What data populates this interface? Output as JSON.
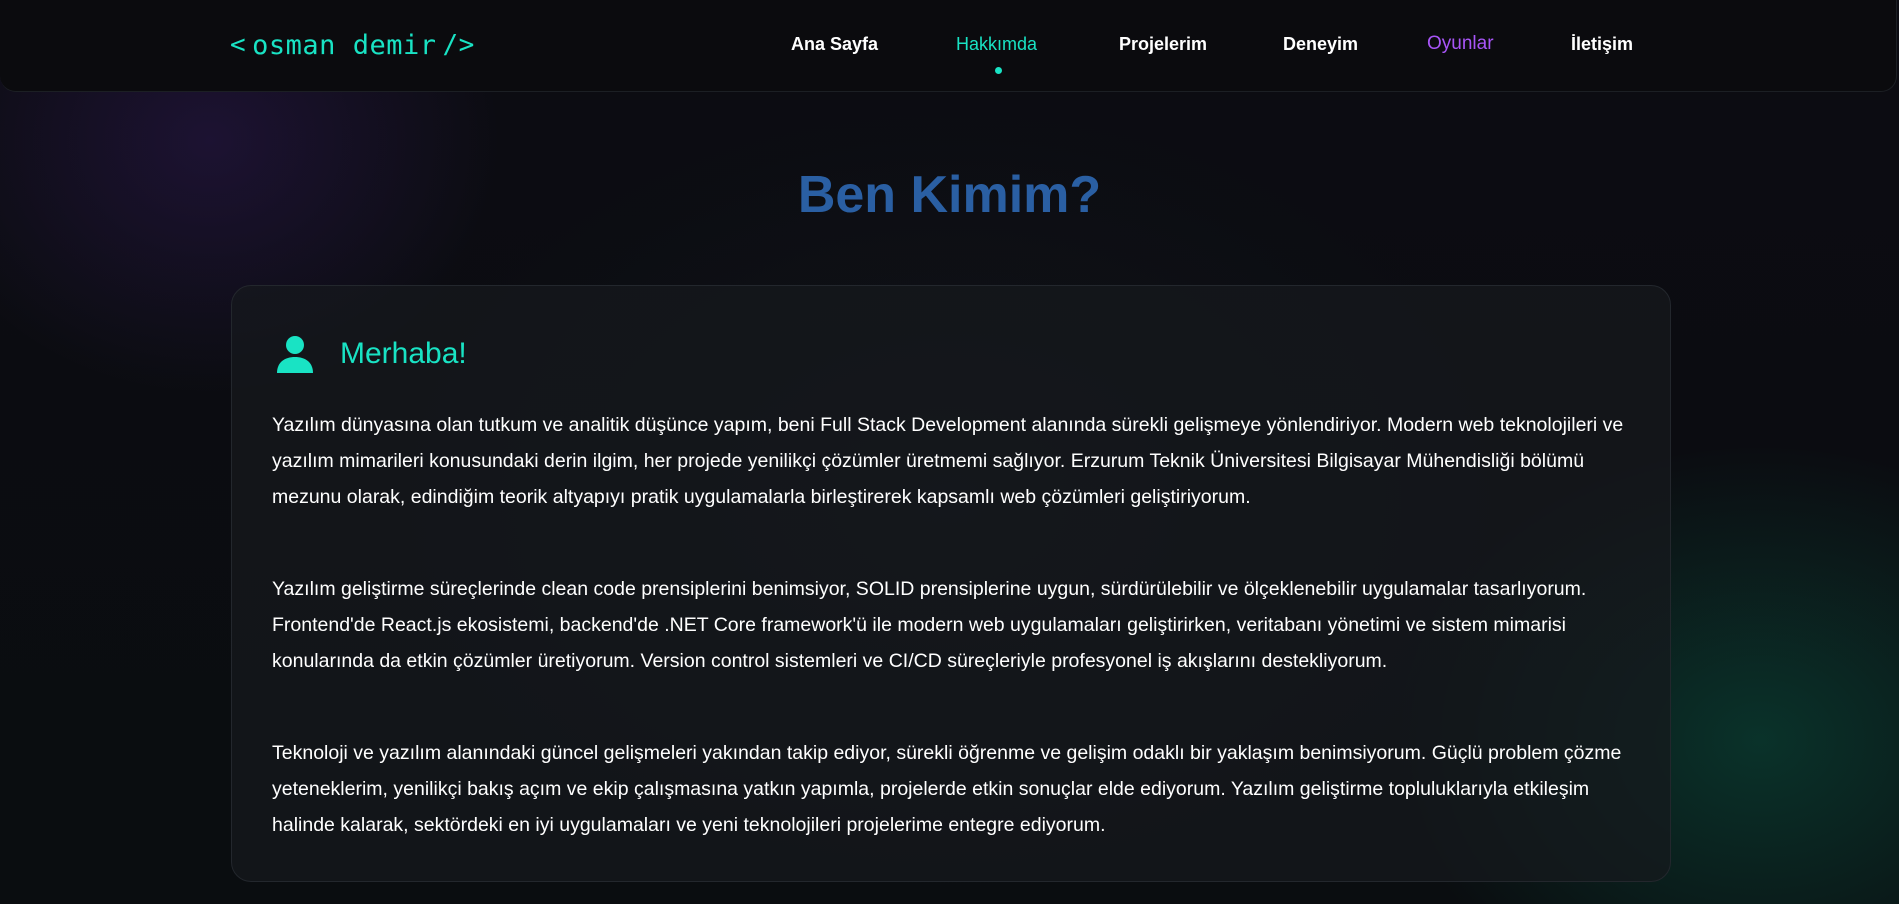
{
  "header": {
    "logo": {
      "open_bracket": "<",
      "name": "osman demir",
      "close_bracket": "/>"
    },
    "nav": [
      {
        "label": "Ana Sayfa"
      },
      {
        "label": "Hakkımda",
        "active": true
      },
      {
        "label": "Projelerim"
      },
      {
        "label": "Deneyim"
      },
      {
        "label": "Oyunlar"
      },
      {
        "label": "İletişim"
      }
    ]
  },
  "main": {
    "title": "Ben Kimim?",
    "card": {
      "icon": "user-icon",
      "heading": "Merhaba!",
      "paragraphs": [
        "Yazılım dünyasına olan tutkum ve analitik düşünce yapım, beni Full Stack Development alanında sürekli gelişmeye yönlendiriyor. Modern web teknolojileri ve yazılım mimarileri konusundaki derin ilgim, her projede yenilikçi çözümler üretmemi sağlıyor. Erzurum Teknik Üniversitesi Bilgisayar Mühendisliği bölümü mezunu olarak, edindiğim teorik altyapıyı pratik uygulamalarla birleştirerek kapsamlı web çözümleri geliştiriyorum.",
        "Yazılım geliştirme süreçlerinde clean code prensiplerini benimsiyor, SOLID prensiplerine uygun, sürdürülebilir ve ölçeklenebilir uygulamalar tasarlıyorum. Frontend'de React.js ekosistemi, backend'de .NET Core framework'ü ile modern web uygulamaları geliştirirken, veritabanı yönetimi ve sistem mimarisi konularında da etkin çözümler üretiyorum. Version control sistemleri ve CI/CD süreçleriyle profesyonel iş akışlarını destekliyorum.",
        "Teknoloji ve yazılım alanındaki güncel gelişmeleri yakından takip ediyor, sürekli öğrenme ve gelişim odaklı bir yaklaşım benimsiyorum. Güçlü problem çözme yeteneklerim, yenilikçi bakış açım ve ekip çalışmasına yatkın yapımla, projelerde etkin sonuçlar elde ediyorum. Yazılım geliştirme topluluklarıyla etkileşim halinde kalarak, sektördeki en iyi uygulamaları ve yeni teknolojileri projelerime entegre ediyorum."
      ]
    }
  },
  "colors": {
    "accent": "#19e3c4",
    "title": "#2a5fa3",
    "games_link": "#a855f7",
    "background": "#0b0d10"
  }
}
